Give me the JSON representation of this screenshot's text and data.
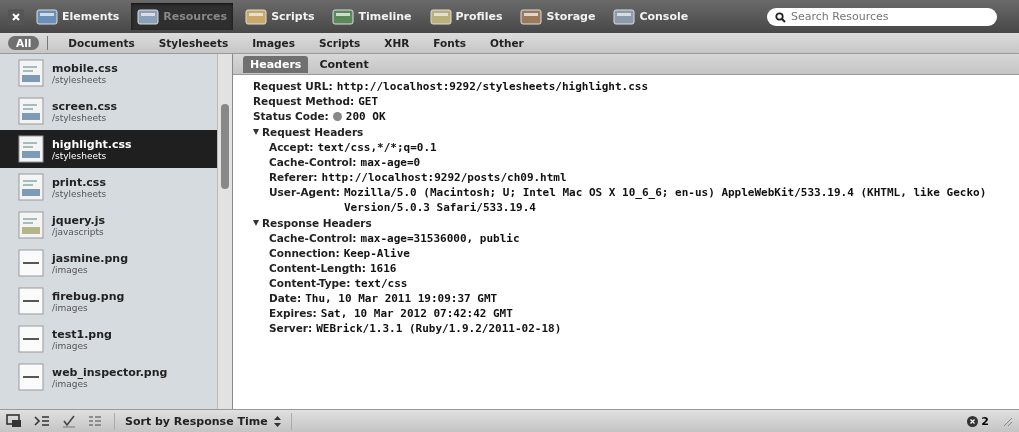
{
  "toolbar": {
    "tabs": [
      {
        "label": "Elements",
        "selected": false
      },
      {
        "label": "Resources",
        "selected": true
      },
      {
        "label": "Scripts",
        "selected": false
      },
      {
        "label": "Timeline",
        "selected": false
      },
      {
        "label": "Profiles",
        "selected": false
      },
      {
        "label": "Storage",
        "selected": false
      },
      {
        "label": "Console",
        "selected": false
      }
    ],
    "search": {
      "placeholder": "Search Resources"
    }
  },
  "filters": [
    {
      "label": "All",
      "selected": true
    },
    {
      "label": "Documents",
      "selected": false
    },
    {
      "label": "Stylesheets",
      "selected": false
    },
    {
      "label": "Images",
      "selected": false
    },
    {
      "label": "Scripts",
      "selected": false
    },
    {
      "label": "XHR",
      "selected": false
    },
    {
      "label": "Fonts",
      "selected": false
    },
    {
      "label": "Other",
      "selected": false
    }
  ],
  "resources": [
    {
      "name": "mobile.css",
      "path": "/stylesheets",
      "kind": "css",
      "selected": false
    },
    {
      "name": "screen.css",
      "path": "/stylesheets",
      "kind": "css",
      "selected": false
    },
    {
      "name": "highlight.css",
      "path": "/stylesheets",
      "kind": "css",
      "selected": true
    },
    {
      "name": "print.css",
      "path": "/stylesheets",
      "kind": "css",
      "selected": false
    },
    {
      "name": "jquery.js",
      "path": "/javascripts",
      "kind": "js",
      "selected": false
    },
    {
      "name": "jasmine.png",
      "path": "/images",
      "kind": "image",
      "selected": false
    },
    {
      "name": "firebug.png",
      "path": "/images",
      "kind": "image",
      "selected": false
    },
    {
      "name": "test1.png",
      "path": "/images",
      "kind": "image",
      "selected": false
    },
    {
      "name": "web_inspector.png",
      "path": "/images",
      "kind": "image",
      "selected": false
    }
  ],
  "detail_tabs": [
    {
      "label": "Headers",
      "selected": true
    },
    {
      "label": "Content",
      "selected": false
    }
  ],
  "general": [
    {
      "name": "Request URL:",
      "value": "http://localhost:9292/stylesheets/highlight.css",
      "kind": "plain"
    },
    {
      "name": "Request Method:",
      "value": "GET",
      "kind": "plain"
    },
    {
      "name": "Status Code:",
      "value": "200 OK",
      "kind": "status"
    }
  ],
  "sections": [
    {
      "title": "Request Headers",
      "expanded": true,
      "headers": [
        {
          "name": "Accept:",
          "value": "text/css,*/*;q=0.1"
        },
        {
          "name": "Cache-Control:",
          "value": "max-age=0"
        },
        {
          "name": "Referer:",
          "value": "http://localhost:9292/posts/ch09.html"
        },
        {
          "name": "User-Agent:",
          "value": "Mozilla/5.0 (Macintosh; U; Intel Mac OS X 10_6_6; en-us) AppleWebKit/533.19.4 (KHTML, like Gecko) Version/5.0.3 Safari/533.19.4"
        }
      ]
    },
    {
      "title": "Response Headers",
      "expanded": true,
      "headers": [
        {
          "name": "Cache-Control:",
          "value": "max-age=31536000, public"
        },
        {
          "name": "Connection:",
          "value": "Keep-Alive"
        },
        {
          "name": "Content-Length:",
          "value": "1616"
        },
        {
          "name": "Content-Type:",
          "value": "text/css"
        },
        {
          "name": "Date:",
          "value": "Thu, 10 Mar 2011 19:09:37 GMT"
        },
        {
          "name": "Expires:",
          "value": "Sat, 10 Mar 2012 07:42:42 GMT"
        },
        {
          "name": "Server:",
          "value": "WEBrick/1.3.1 (Ruby/1.9.2/2011-02-18)"
        }
      ]
    }
  ],
  "status_bar": {
    "sort": "Sort by Response Time",
    "error_count": "2"
  }
}
